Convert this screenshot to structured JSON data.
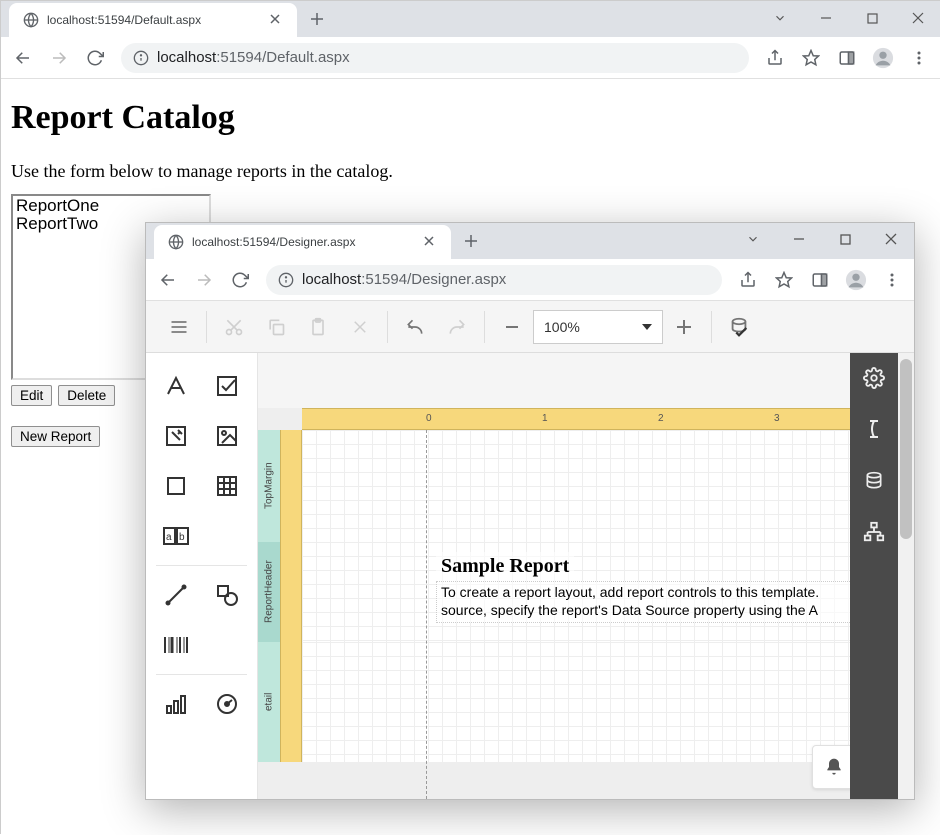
{
  "parent_window": {
    "tab_title": "localhost:51594/Default.aspx",
    "url_host": "localhost",
    "url_port_path": ":51594/Default.aspx"
  },
  "page": {
    "heading": "Report Catalog",
    "intro": "Use the form below to manage reports in the catalog.",
    "list_items": [
      "ReportOne",
      "ReportTwo"
    ],
    "edit_label": "Edit",
    "delete_label": "Delete",
    "new_label": "New Report"
  },
  "popup_window": {
    "tab_title": "localhost:51594/Designer.aspx",
    "url_host": "localhost",
    "url_port_path": ":51594/Designer.aspx"
  },
  "designer": {
    "zoom_value": "100%",
    "ruler_marks": [
      "0",
      "1",
      "2",
      "3"
    ],
    "bands": {
      "top_margin": "TopMargin",
      "report_header": "ReportHeader",
      "detail": "etail"
    },
    "report_title": "Sample Report",
    "report_text_line1": "To create a report layout, add report controls to this template.",
    "report_text_line2": "source, specify the report's  Data Source property using the A"
  }
}
